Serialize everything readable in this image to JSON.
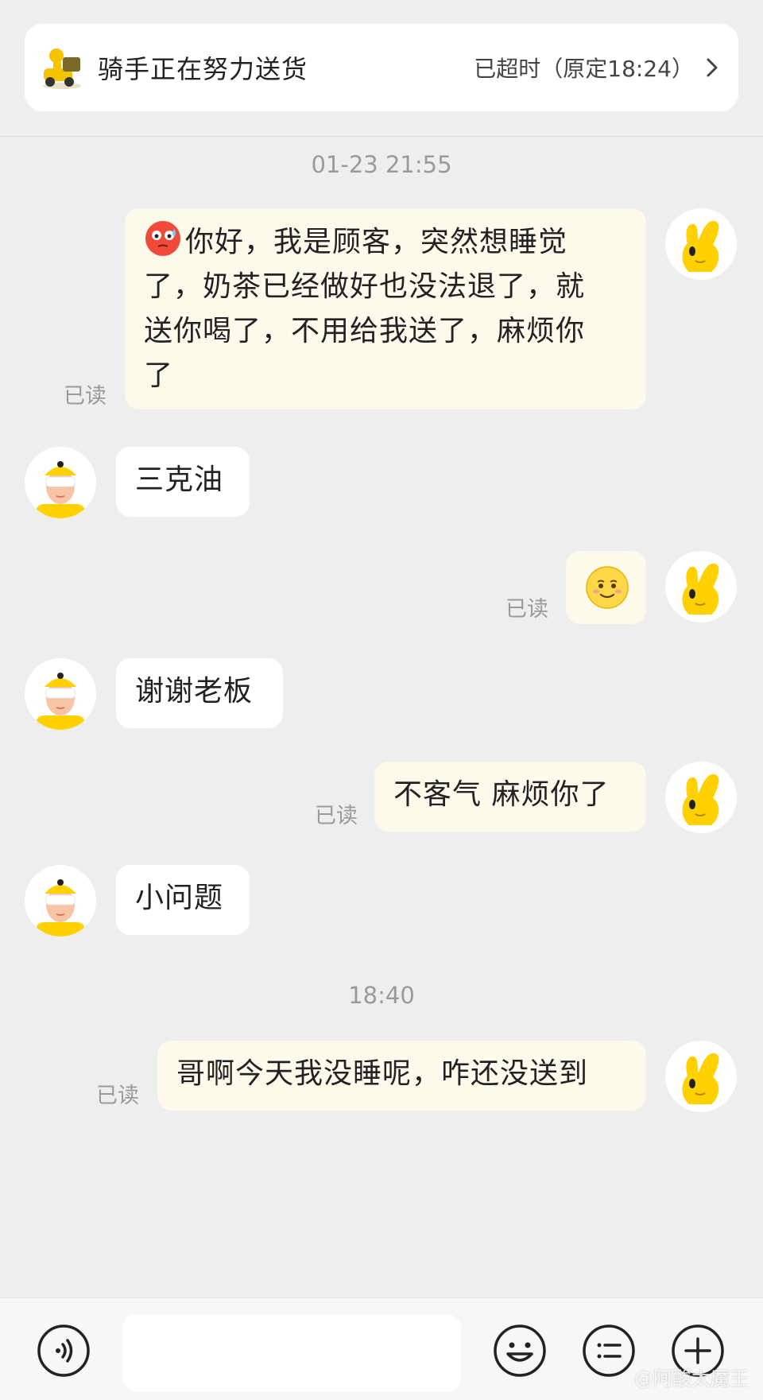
{
  "header": {
    "title": "骑手正在努力送货",
    "status": "已超时（原定18:24）"
  },
  "timestamps": [
    "01-23 21:55",
    "18:40"
  ],
  "messages": [
    {
      "from": "me",
      "text": "你好，我是顾客，突然想睡觉了，奶茶已经做好也没法退了，就送你喝了，不用给我送了，麻烦你了",
      "lines": [
        "你好，我是顾客，突然想睡觉",
        "了，奶茶已经做好也没法退了，就",
        "送你喝了，不用给我送了，麻烦你",
        "了"
      ],
      "read": "已读",
      "leading_emoji": "flushed-face-emoji"
    },
    {
      "from": "rider",
      "text": "三克油"
    },
    {
      "from": "me",
      "text": "",
      "emoji": "smiling-face-emoji",
      "read": "已读"
    },
    {
      "from": "rider",
      "text": "谢谢老板"
    },
    {
      "from": "me",
      "text": "不客气 麻烦你了",
      "read": "已读"
    },
    {
      "from": "rider",
      "text": "小问题"
    },
    {
      "from": "me",
      "text": "哥啊今天我没睡呢，咋还没送到",
      "read": "已读"
    }
  ],
  "toolbar": {
    "icons": [
      "voice-icon",
      "emoji-icon",
      "quick-reply-icon",
      "plus-icon"
    ]
  },
  "watermark": "@阿酸太魔王",
  "colors": {
    "background": "#eeeeee",
    "my_bubble": "#fdfaec",
    "their_bubble": "#ffffff",
    "accent_yellow": "#ffd100",
    "muted_text": "#9a9a9a"
  }
}
